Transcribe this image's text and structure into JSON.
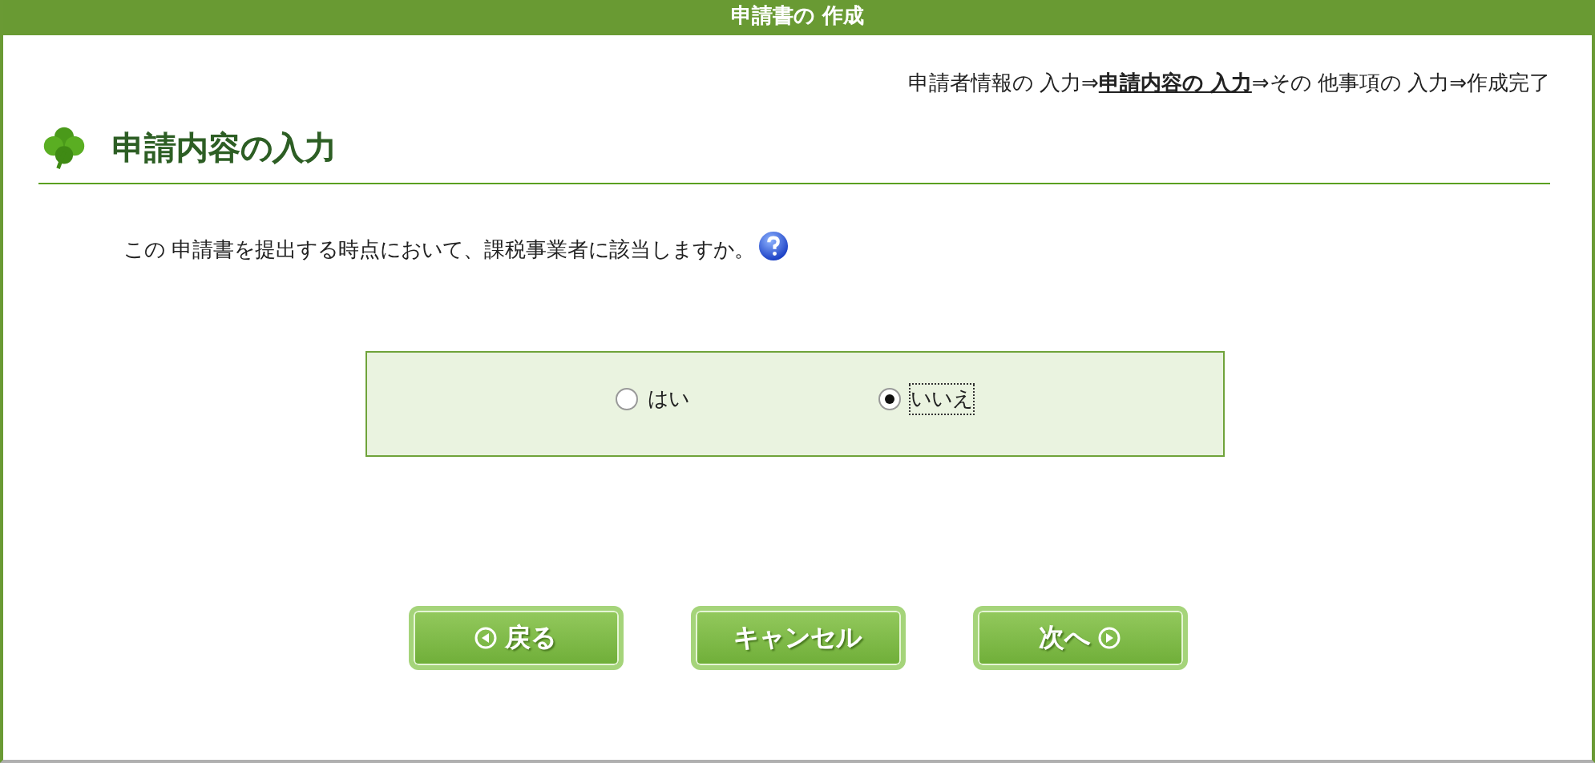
{
  "window": {
    "title": "申請書の 作成"
  },
  "steps": [
    {
      "label": "申請者情報の 入力",
      "current": false
    },
    {
      "label": "申請内容の 入力",
      "current": true
    },
    {
      "label": "その 他事項の 入力",
      "current": false
    },
    {
      "label": "作成完了",
      "current": false
    }
  ],
  "step_separator": "⇒",
  "heading": "申請内容の入力",
  "question": "この 申請書を提出する時点において、課税事業者に該当しますか。",
  "options": [
    {
      "label": "はい",
      "selected": false
    },
    {
      "label": "いいえ",
      "selected": true
    }
  ],
  "buttons": [
    {
      "label": "戻る",
      "kind": "back"
    },
    {
      "label": "キャンセル",
      "kind": "cancel"
    },
    {
      "label": "次へ",
      "kind": "next"
    }
  ]
}
